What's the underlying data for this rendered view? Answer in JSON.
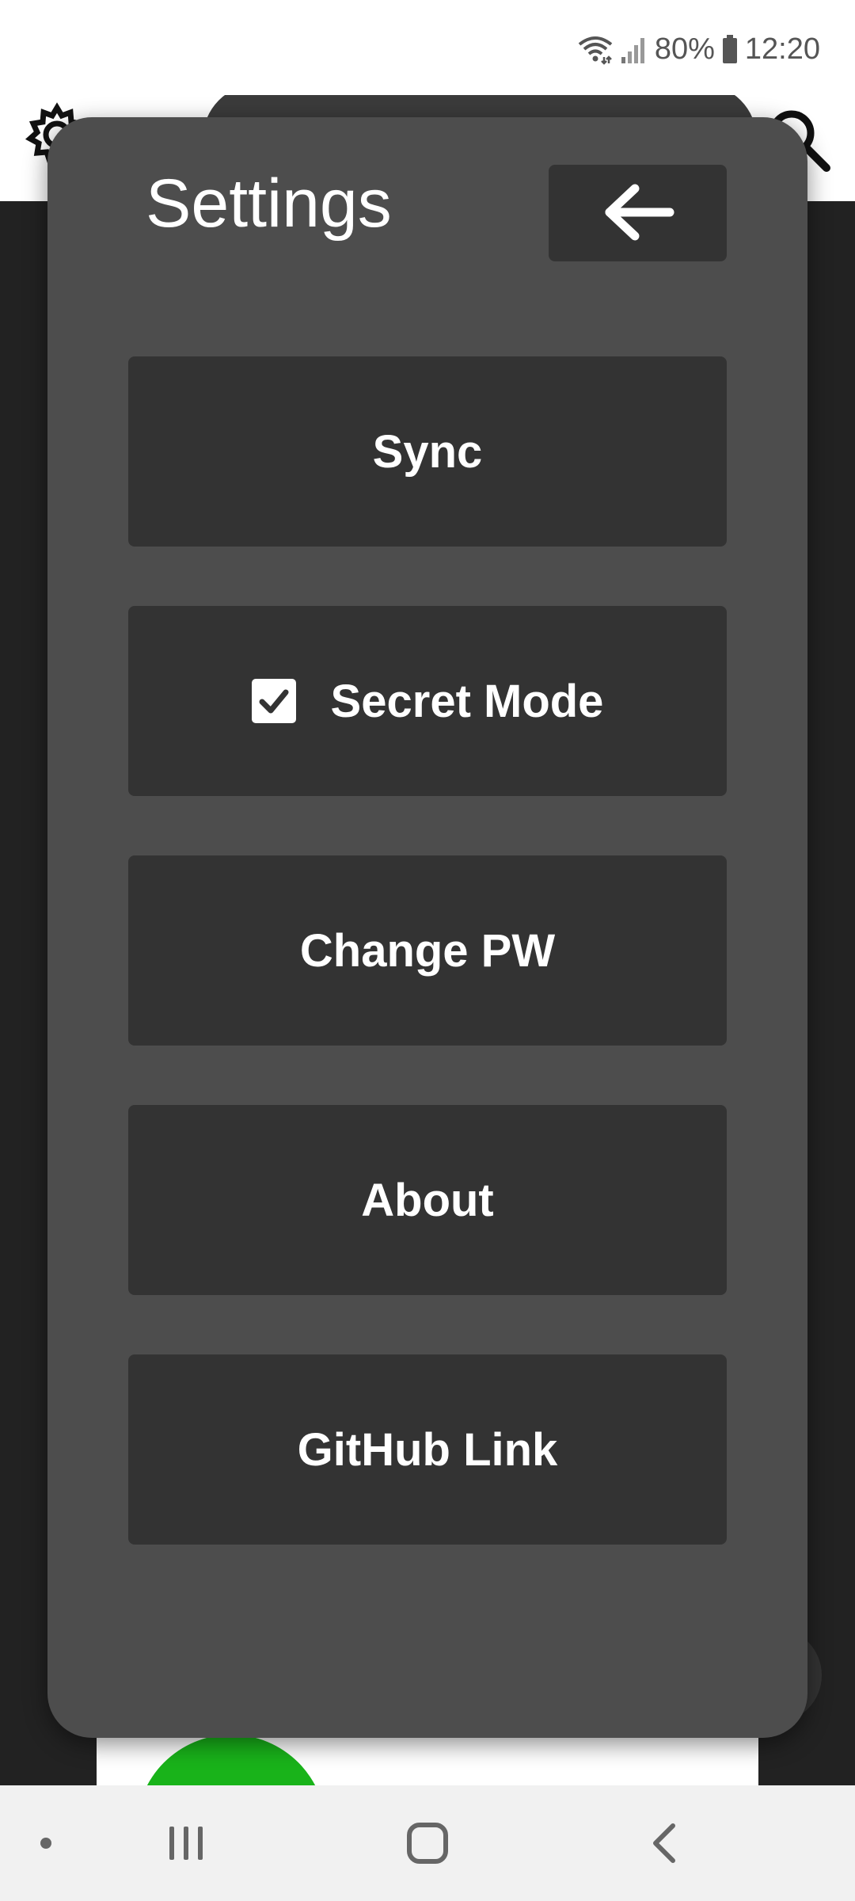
{
  "status_bar": {
    "battery": "80%",
    "time": "12:20"
  },
  "settings": {
    "title": "Settings",
    "back_icon": "arrow-left-icon",
    "items": [
      {
        "label": "Sync"
      },
      {
        "label": "Secret Mode",
        "checked": true
      },
      {
        "label": "Change PW"
      },
      {
        "label": "About"
      },
      {
        "label": "GitHub Link"
      }
    ]
  },
  "colors": {
    "dialog_background": "#4d4d4d",
    "button_background": "#333333",
    "text": "#ffffff",
    "avatar_green": "#19b31a"
  },
  "nav_bar": {
    "icons": [
      "dot-icon",
      "recent-apps-icon",
      "home-icon",
      "back-icon"
    ]
  }
}
